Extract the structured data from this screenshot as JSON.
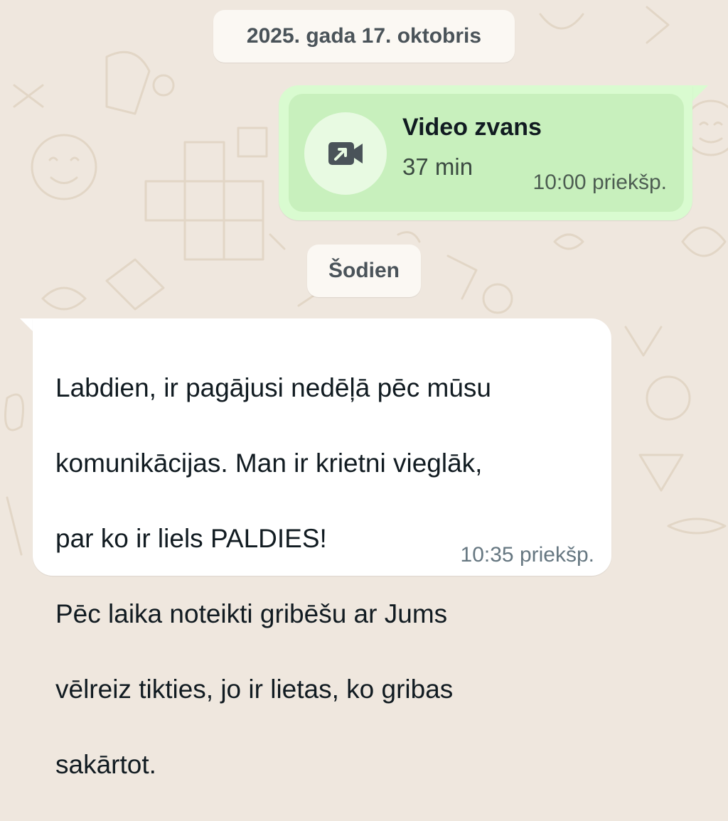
{
  "date_separator": "2025. gada 17. oktobris",
  "today_separator": "Šodien",
  "call_message": {
    "title": "Video zvans",
    "duration": "37 min",
    "time": "10:00 priekšp.",
    "icon": "outgoing-video-call-icon"
  },
  "text_message": {
    "lines": [
      "Labdien, ir pagājusi nedēļā pēc mūsu",
      "komunikācijas. Man ir krietni vieglāk,",
      "par ko ir liels PALDIES!",
      "Pēc laika noteikti gribēšu ar Jums",
      "vēlreiz tikties, jo ir lietas, ko gribas",
      "sakārtot."
    ],
    "time": "10:35 priekšp."
  },
  "colors": {
    "wallpaper": "#efe7de",
    "outgoing_bubble": "#d9fbd0",
    "incoming_bubble": "#ffffff",
    "chip": "#fbf8f3"
  }
}
